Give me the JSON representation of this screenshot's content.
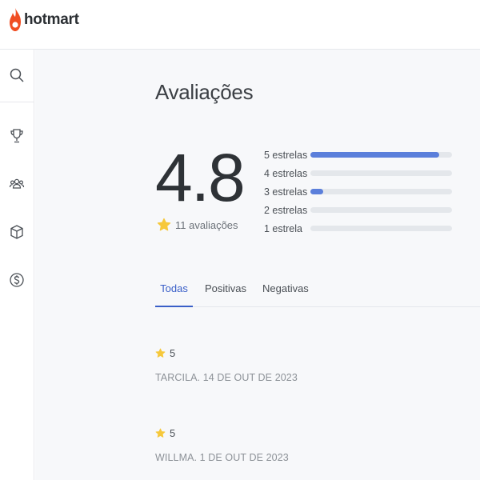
{
  "brand": {
    "name": "hotmart",
    "accent": "#f04e23"
  },
  "sidebar": {
    "items": [
      {
        "icon": "search-icon"
      },
      {
        "icon": "trophy-icon"
      },
      {
        "icon": "users-icon"
      },
      {
        "icon": "box-icon"
      },
      {
        "icon": "dollar-icon"
      }
    ]
  },
  "page": {
    "title": "Avaliações"
  },
  "summary": {
    "score": "4.8",
    "count_label": "11 avaliações",
    "distribution": [
      {
        "label": "5 estrelas",
        "fraction": 0.91
      },
      {
        "label": "4 estrelas",
        "fraction": 0
      },
      {
        "label": "3 estrelas",
        "fraction": 0.09
      },
      {
        "label": "2 estrelas",
        "fraction": 0
      },
      {
        "label": "1 estrela",
        "fraction": 0
      }
    ],
    "bar_color": "#5b7fdb"
  },
  "tabs": [
    {
      "label": "Todas",
      "active": true
    },
    {
      "label": "Positivas",
      "active": false
    },
    {
      "label": "Negativas",
      "active": false
    }
  ],
  "reviews": [
    {
      "rating": "5",
      "meta": "TARCILA. 14 DE OUT DE 2023"
    },
    {
      "rating": "5",
      "meta": "WILLMA. 1 DE OUT DE 2023"
    }
  ]
}
